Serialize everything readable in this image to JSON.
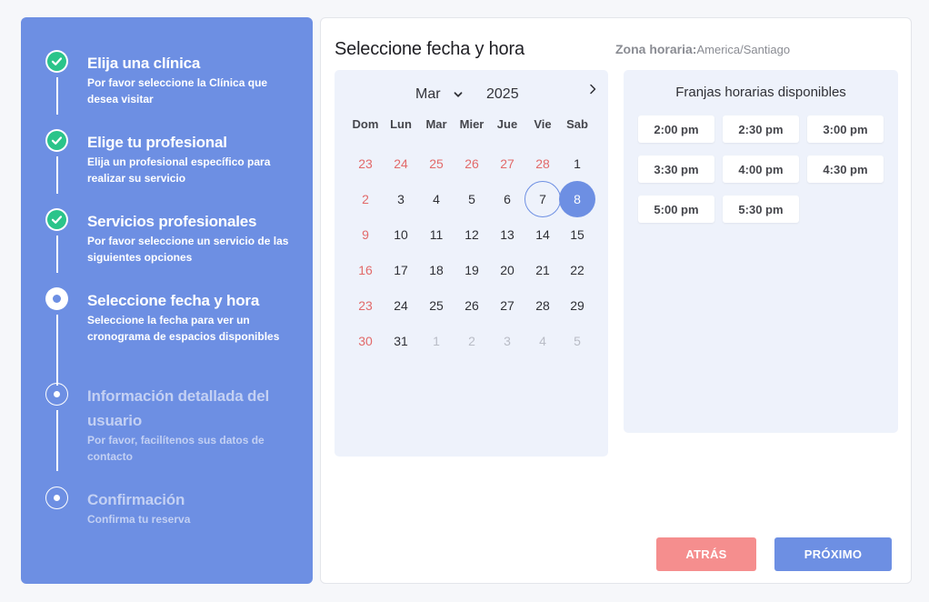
{
  "steps": [
    {
      "title": "Elija una clínica",
      "desc": "Por favor seleccione la Clínica que desea visitar",
      "state": "done"
    },
    {
      "title": "Elige tu profesional",
      "desc": "Elija un profesional específico para realizar su servicio",
      "state": "done"
    },
    {
      "title": "Servicios profesionales",
      "desc": "Por favor seleccione un servicio de las siguientes opciones",
      "state": "done"
    },
    {
      "title": "Seleccione fecha y hora",
      "desc": "Seleccione la fecha para ver un cronograma de espacios disponibles",
      "state": "current"
    },
    {
      "title": "Información detallada del usuario",
      "desc": "Por favor, facilítenos sus datos de contacto",
      "state": "pending"
    },
    {
      "title": "Confirmación",
      "desc": "Confirma tu reserva",
      "state": "pending"
    }
  ],
  "main": {
    "title": "Seleccione fecha y hora",
    "timezone_label": "Zona horaria:",
    "timezone_value": "America/Santiago"
  },
  "calendar": {
    "month": "Mar",
    "year": "2025",
    "weekdays": [
      "Dom",
      "Lun",
      "Mar",
      "Mier",
      "Jue",
      "Vie",
      "Sab"
    ],
    "weeks": [
      [
        "23",
        "24",
        "25",
        "26",
        "27",
        "28",
        "1"
      ],
      [
        "2",
        "3",
        "4",
        "5",
        "6",
        "7",
        "8"
      ],
      [
        "9",
        "10",
        "11",
        "12",
        "13",
        "14",
        "15"
      ],
      [
        "16",
        "17",
        "18",
        "19",
        "20",
        "21",
        "22"
      ],
      [
        "23",
        "24",
        "25",
        "26",
        "27",
        "28",
        "29"
      ],
      [
        "30",
        "31",
        "1",
        "2",
        "3",
        "4",
        "5"
      ]
    ],
    "today": "7",
    "selected": "8"
  },
  "slots": {
    "title": "Franjas horarias disponibles",
    "times": [
      "2:00 pm",
      "2:30 pm",
      "3:00 pm",
      "3:30 pm",
      "4:00 pm",
      "4:30 pm",
      "5:00 pm",
      "5:30 pm"
    ]
  },
  "buttons": {
    "back": "ATRÁS",
    "next": "PRÓXIMO"
  },
  "colors": {
    "accent": "#6d8fe3",
    "done": "#2bc48a",
    "back": "#f58e8e",
    "weekend": "#e26a6a"
  }
}
